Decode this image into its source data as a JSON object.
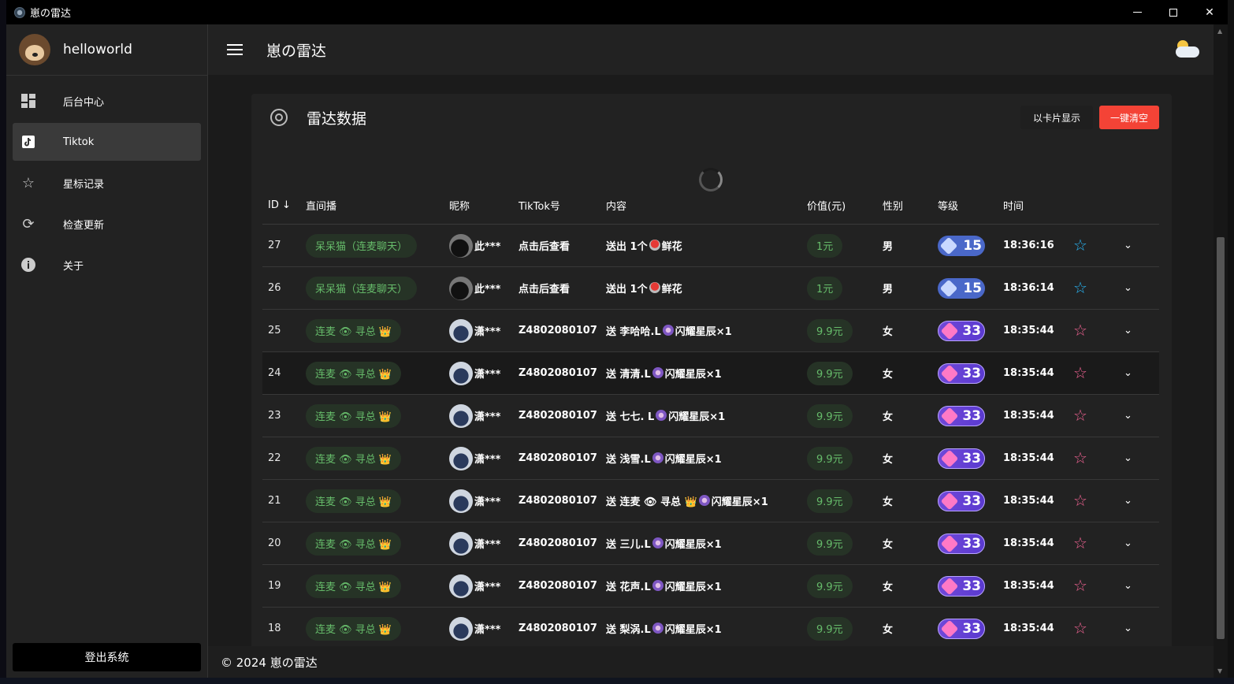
{
  "window": {
    "title": "崽の雷达"
  },
  "sidebar": {
    "username": "helloworld",
    "items": [
      {
        "label": "后台中心",
        "icon": "dashboard-icon"
      },
      {
        "label": "Tiktok",
        "icon": "tiktok-icon"
      },
      {
        "label": "星标记录",
        "icon": "star-list-icon"
      },
      {
        "label": "检查更新",
        "icon": "refresh-icon"
      },
      {
        "label": "关于",
        "icon": "info-icon"
      }
    ],
    "active_index": 1,
    "logout_label": "登出系统"
  },
  "appbar": {
    "title": "崽の雷达"
  },
  "card": {
    "title": "雷达数据",
    "card_view_label": "以卡片显示",
    "clear_label": "一键清空"
  },
  "table": {
    "headers": {
      "id": "ID",
      "live": "直间播",
      "nick": "昵称",
      "tiktok": "TikTok号",
      "content": "内容",
      "value": "价值(元)",
      "sex": "性别",
      "level": "等级",
      "time": "时间"
    },
    "rows": [
      {
        "id": "27",
        "live": "呆呆猫（连麦聊天）",
        "nick": "此***",
        "tiktok": "点击后查看",
        "content_pre": "送出 1个",
        "content_post": "鲜花",
        "gift": "flower",
        "value": "1元",
        "sex": "男",
        "level": "15",
        "time": "18:36:16"
      },
      {
        "id": "26",
        "live": "呆呆猫（连麦聊天）",
        "nick": "此***",
        "tiktok": "点击后查看",
        "content_pre": "送出 1个",
        "content_post": "鲜花",
        "gift": "flower",
        "value": "1元",
        "sex": "男",
        "level": "15",
        "time": "18:36:14"
      },
      {
        "id": "25",
        "live": "连麦 👁 寻总 👑",
        "nick": "潇***",
        "tiktok": "Z4802080107",
        "content_pre": "送 李哈哈.L",
        "content_post": "闪耀星辰×1",
        "gift": "star",
        "value": "9.9元",
        "sex": "女",
        "level": "33",
        "time": "18:35:44"
      },
      {
        "id": "24",
        "live": "连麦 👁 寻总 👑",
        "nick": "潇***",
        "tiktok": "Z4802080107",
        "content_pre": "送 清清.L",
        "content_post": "闪耀星辰×1",
        "gift": "star",
        "value": "9.9元",
        "sex": "女",
        "level": "33",
        "time": "18:35:44"
      },
      {
        "id": "23",
        "live": "连麦 👁 寻总 👑",
        "nick": "潇***",
        "tiktok": "Z4802080107",
        "content_pre": "送 七七. L",
        "content_post": "闪耀星辰×1",
        "gift": "star",
        "value": "9.9元",
        "sex": "女",
        "level": "33",
        "time": "18:35:44"
      },
      {
        "id": "22",
        "live": "连麦 👁 寻总 👑",
        "nick": "潇***",
        "tiktok": "Z4802080107",
        "content_pre": "送 浅雪.L",
        "content_post": "闪耀星辰×1",
        "gift": "star",
        "value": "9.9元",
        "sex": "女",
        "level": "33",
        "time": "18:35:44"
      },
      {
        "id": "21",
        "live": "连麦 👁 寻总 👑",
        "nick": "潇***",
        "tiktok": "Z4802080107",
        "content_pre": "送 连麦 👁 寻总 👑",
        "content_post": "闪耀星辰×1",
        "gift": "star",
        "value": "9.9元",
        "sex": "女",
        "level": "33",
        "time": "18:35:44"
      },
      {
        "id": "20",
        "live": "连麦 👁 寻总 👑",
        "nick": "潇***",
        "tiktok": "Z4802080107",
        "content_pre": "送 三儿.L",
        "content_post": "闪耀星辰×1",
        "gift": "star",
        "value": "9.9元",
        "sex": "女",
        "level": "33",
        "time": "18:35:44"
      },
      {
        "id": "19",
        "live": "连麦 👁 寻总 👑",
        "nick": "潇***",
        "tiktok": "Z4802080107",
        "content_pre": "送 花声.L",
        "content_post": "闪耀星辰×1",
        "gift": "star",
        "value": "9.9元",
        "sex": "女",
        "level": "33",
        "time": "18:35:44"
      },
      {
        "id": "18",
        "live": "连麦 👁 寻总 👑",
        "nick": "潇***",
        "tiktok": "Z4802080107",
        "content_pre": "送 梨涡.L",
        "content_post": "闪耀星辰×1",
        "gift": "star",
        "value": "9.9元",
        "sex": "女",
        "level": "33",
        "time": "18:35:44"
      }
    ]
  },
  "footer": {
    "text": "© 2024 崽の雷达"
  },
  "colors": {
    "accent_red": "#f44336",
    "chip_green": "#66bb6a",
    "star_cyan": "#29b6f6",
    "star_pink": "#f06292"
  }
}
